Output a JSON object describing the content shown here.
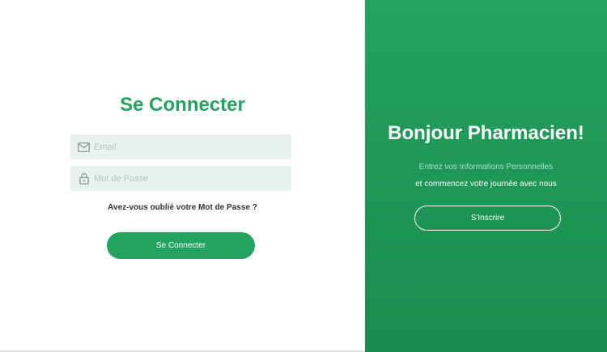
{
  "login": {
    "title": "Se Connecter",
    "email": {
      "placeholder": "Email",
      "value": "",
      "icon": "mail-icon"
    },
    "password": {
      "placeholder": "Mot de Passe",
      "value": "",
      "icon": "lock-icon"
    },
    "forgot_link": "Avez-vous oublié votre Mot de Passe ?",
    "submit_label": "Se Connecter"
  },
  "welcome": {
    "title": "Bonjour Pharmacien!",
    "line1": "Entrez vos Informations Personnelles",
    "line2": "et commencez votre journée avec nous",
    "signup_label": "S'Inscrire"
  },
  "colors": {
    "brand_green": "#23a360",
    "panel_green_top": "#23a360",
    "panel_green_bottom": "#1a8b4e",
    "field_background": "#e8f3f1",
    "placeholder_text": "#b9c2c0",
    "muted_text": "#a9e0c4"
  }
}
